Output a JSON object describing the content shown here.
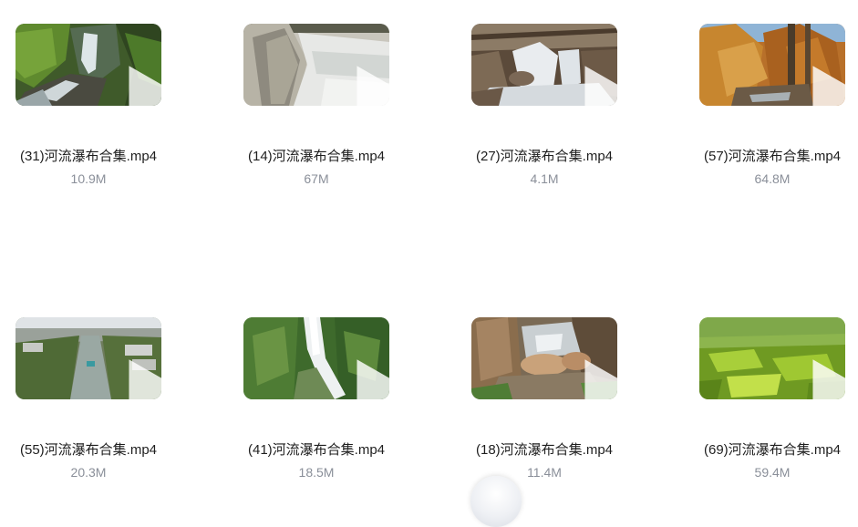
{
  "files": [
    {
      "name": "(31)河流瀑布合集.mp4",
      "size": "10.9M",
      "thumb": "mossy-waterfall"
    },
    {
      "name": "(14)河流瀑布合集.mp4",
      "size": "67M",
      "thumb": "weir-rapids"
    },
    {
      "name": "(27)河流瀑布合集.mp4",
      "size": "4.1M",
      "thumb": "forest-cascade"
    },
    {
      "name": "(57)河流瀑布合集.mp4",
      "size": "64.8M",
      "thumb": "autumn-larch-creek"
    },
    {
      "name": "(55)河流瀑布合集.mp4",
      "size": "20.3M",
      "thumb": "aerial-canal-town"
    },
    {
      "name": "(41)河流瀑布合集.mp4",
      "size": "18.5M",
      "thumb": "jungle-waterfall"
    },
    {
      "name": "(18)河流瀑布合集.mp4",
      "size": "11.4M",
      "thumb": "rocky-stream"
    },
    {
      "name": "(69)河流瀑布合集.mp4",
      "size": "59.4M",
      "thumb": "green-clear-water"
    }
  ],
  "icons": {
    "play": "play-icon",
    "floating": "floating-action-button"
  }
}
